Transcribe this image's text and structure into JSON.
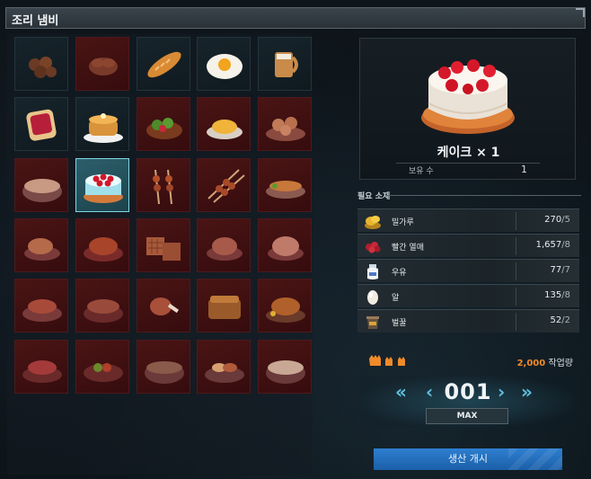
{
  "window": {
    "title": "조리 냄비"
  },
  "grid": {
    "items": [
      {
        "name": "chestnuts",
        "state": "open"
      },
      {
        "name": "mushrooms",
        "state": "locked"
      },
      {
        "name": "baguette",
        "state": "open"
      },
      {
        "name": "fried-egg",
        "state": "open"
      },
      {
        "name": "milk-mug",
        "state": "open"
      },
      {
        "name": "jam-toast",
        "state": "open"
      },
      {
        "name": "pancakes",
        "state": "open"
      },
      {
        "name": "salad",
        "state": "locked"
      },
      {
        "name": "omelette",
        "state": "locked"
      },
      {
        "name": "bread-rolls",
        "state": "locked"
      },
      {
        "name": "soup-bowl",
        "state": "locked"
      },
      {
        "name": "cake",
        "state": "selected"
      },
      {
        "name": "skewers",
        "state": "locked"
      },
      {
        "name": "kebabs",
        "state": "locked"
      },
      {
        "name": "grilled-fish",
        "state": "locked"
      },
      {
        "name": "roast-chicken-leg",
        "state": "locked"
      },
      {
        "name": "roast-bird",
        "state": "locked"
      },
      {
        "name": "waffles",
        "state": "locked"
      },
      {
        "name": "meat-cutlet",
        "state": "locked"
      },
      {
        "name": "ham",
        "state": "locked"
      },
      {
        "name": "meat-plate",
        "state": "locked"
      },
      {
        "name": "stew-pot",
        "state": "locked"
      },
      {
        "name": "drumstick",
        "state": "locked"
      },
      {
        "name": "meat-pie",
        "state": "locked"
      },
      {
        "name": "roast-turkey",
        "state": "locked"
      },
      {
        "name": "steak",
        "state": "locked"
      },
      {
        "name": "salad-bowl",
        "state": "locked"
      },
      {
        "name": "broth",
        "state": "locked"
      },
      {
        "name": "breakfast-plate",
        "state": "locked"
      },
      {
        "name": "cream-soup",
        "state": "locked"
      }
    ]
  },
  "preview": {
    "name": "케이크 × 1",
    "owned_label": "보유 수",
    "owned_value": "1"
  },
  "materials": {
    "title": "필요 소재",
    "rows": [
      {
        "name": "밀가루",
        "have": "270",
        "req": "/5",
        "icon": "flour-icon"
      },
      {
        "name": "빨간 열매",
        "have": "1,657",
        "req": "/8",
        "icon": "red-berry-icon"
      },
      {
        "name": "우유",
        "have": "77",
        "req": "/7",
        "icon": "milk-icon"
      },
      {
        "name": "알",
        "have": "135",
        "req": "/8",
        "icon": "egg-icon"
      },
      {
        "name": "벌꿀",
        "have": "52",
        "req": "/2",
        "icon": "honey-icon"
      }
    ]
  },
  "work": {
    "amount": "2,000",
    "label": " 작업량"
  },
  "counter": {
    "left2": "«",
    "left1": "‹",
    "value": "001",
    "right1": "›",
    "right2": "»",
    "max": "MAX"
  },
  "produce": {
    "label": "생산 개시"
  },
  "colors": {
    "accent": "#f08a2a",
    "selected": "#7fd7e6",
    "locked": "#4a1414",
    "button": "#2e7fd0"
  }
}
